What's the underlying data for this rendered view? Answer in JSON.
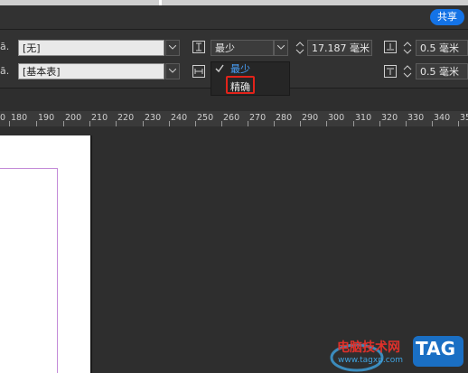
{
  "header": {
    "share_label": "共享"
  },
  "controls": {
    "row1_label": "ā.",
    "row2_label": "ā.",
    "style1_value": "[无]",
    "style2_value": "[基本表]",
    "spacing_mode": "最少",
    "height_value": "17.187 毫米",
    "top_inset": "0.5 毫米",
    "bottom_inset": "0.5 毫米"
  },
  "dropdown": {
    "options": [
      {
        "label": "最少",
        "checked": true
      },
      {
        "label": "精确",
        "checked": false
      }
    ]
  },
  "ruler": {
    "labels": [
      "0",
      "180",
      "190",
      "200",
      "210",
      "220",
      "230",
      "240",
      "250",
      "260",
      "270",
      "280",
      "290",
      "300",
      "310",
      "320",
      "330",
      "340",
      "35"
    ]
  },
  "watermark": {
    "site_name": "电脑技术网",
    "url": "www.tagxp.com",
    "tag": "TAG"
  },
  "colors": {
    "accent": "#1473e6",
    "highlight": "#e2231a",
    "check": "#4aa3ff"
  }
}
